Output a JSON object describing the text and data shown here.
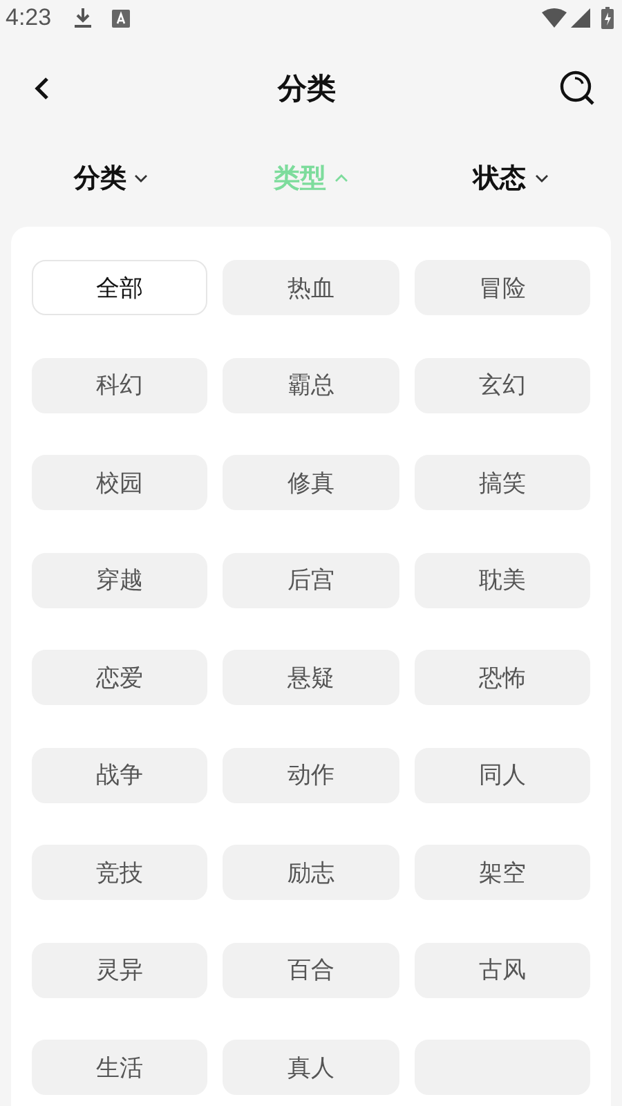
{
  "status_bar": {
    "time": "4:23"
  },
  "header": {
    "title": "分类"
  },
  "filters": [
    {
      "label": "分类",
      "selected": false,
      "expanded": false
    },
    {
      "label": "类型",
      "selected": true,
      "expanded": true
    },
    {
      "label": "状态",
      "selected": false,
      "expanded": false
    }
  ],
  "tags": [
    {
      "label": "全部",
      "selected": true
    },
    {
      "label": "热血",
      "selected": false
    },
    {
      "label": "冒险",
      "selected": false
    },
    {
      "label": "科幻",
      "selected": false
    },
    {
      "label": "霸总",
      "selected": false
    },
    {
      "label": "玄幻",
      "selected": false
    },
    {
      "label": "校园",
      "selected": false
    },
    {
      "label": "修真",
      "selected": false
    },
    {
      "label": "搞笑",
      "selected": false
    },
    {
      "label": "穿越",
      "selected": false
    },
    {
      "label": "后宫",
      "selected": false
    },
    {
      "label": "耽美",
      "selected": false
    },
    {
      "label": "恋爱",
      "selected": false
    },
    {
      "label": "悬疑",
      "selected": false
    },
    {
      "label": "恐怖",
      "selected": false
    },
    {
      "label": "战争",
      "selected": false
    },
    {
      "label": "动作",
      "selected": false
    },
    {
      "label": "同人",
      "selected": false
    },
    {
      "label": "竞技",
      "selected": false
    },
    {
      "label": "励志",
      "selected": false
    },
    {
      "label": "架空",
      "selected": false
    },
    {
      "label": "灵异",
      "selected": false
    },
    {
      "label": "百合",
      "selected": false
    },
    {
      "label": "古风",
      "selected": false
    },
    {
      "label": "生活",
      "selected": false
    },
    {
      "label": "真人",
      "selected": false
    },
    {
      "selected": false
    }
  ]
}
